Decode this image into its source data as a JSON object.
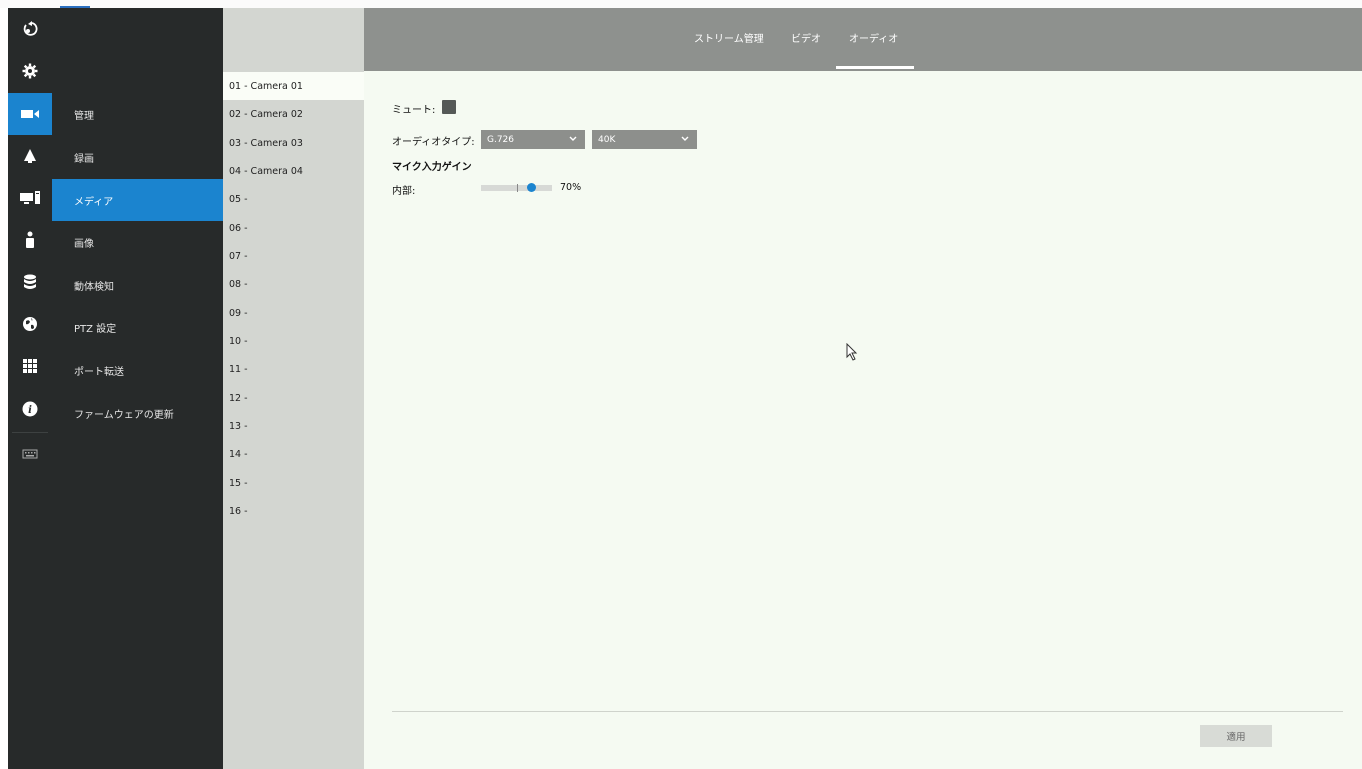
{
  "rail": {
    "icons": [
      "logout-icon",
      "gear-icon",
      "camera-icon",
      "alert-bell-icon",
      "monitor-icon",
      "user-icon",
      "database-icon",
      "globe-icon",
      "grid-icon",
      "info-icon",
      "keyboard-icon"
    ],
    "active_index": 2,
    "accent": "#1b84cf"
  },
  "menu": {
    "items": [
      "管理",
      "録画",
      "メディア",
      "画像",
      "動体検知",
      "PTZ 設定",
      "ポート転送",
      "ファームウェアの更新"
    ],
    "active_index": 2
  },
  "cameras": {
    "items": [
      "01 - Camera 01",
      "02 - Camera 02",
      "03 - Camera 03",
      "04 - Camera 04",
      "05 -",
      "06 -",
      "07 -",
      "08 -",
      "09 -",
      "10 -",
      "11 -",
      "12 -",
      "13 -",
      "14 -",
      "15 -",
      "16 -"
    ],
    "active_index": 0
  },
  "tabs": {
    "items": [
      "ストリーム管理",
      "ビデオ",
      "オーディオ"
    ],
    "active_index": 2
  },
  "audio": {
    "mute_label": "ミュート:",
    "type_label": "オーディオタイプ:",
    "codec_value": "G.726",
    "rate_value": "40K",
    "gain_heading": "マイク入力ゲイン",
    "internal_label": "内部:",
    "gain_value": "70%",
    "gain_fraction": 0.7
  },
  "apply_label": "適用"
}
